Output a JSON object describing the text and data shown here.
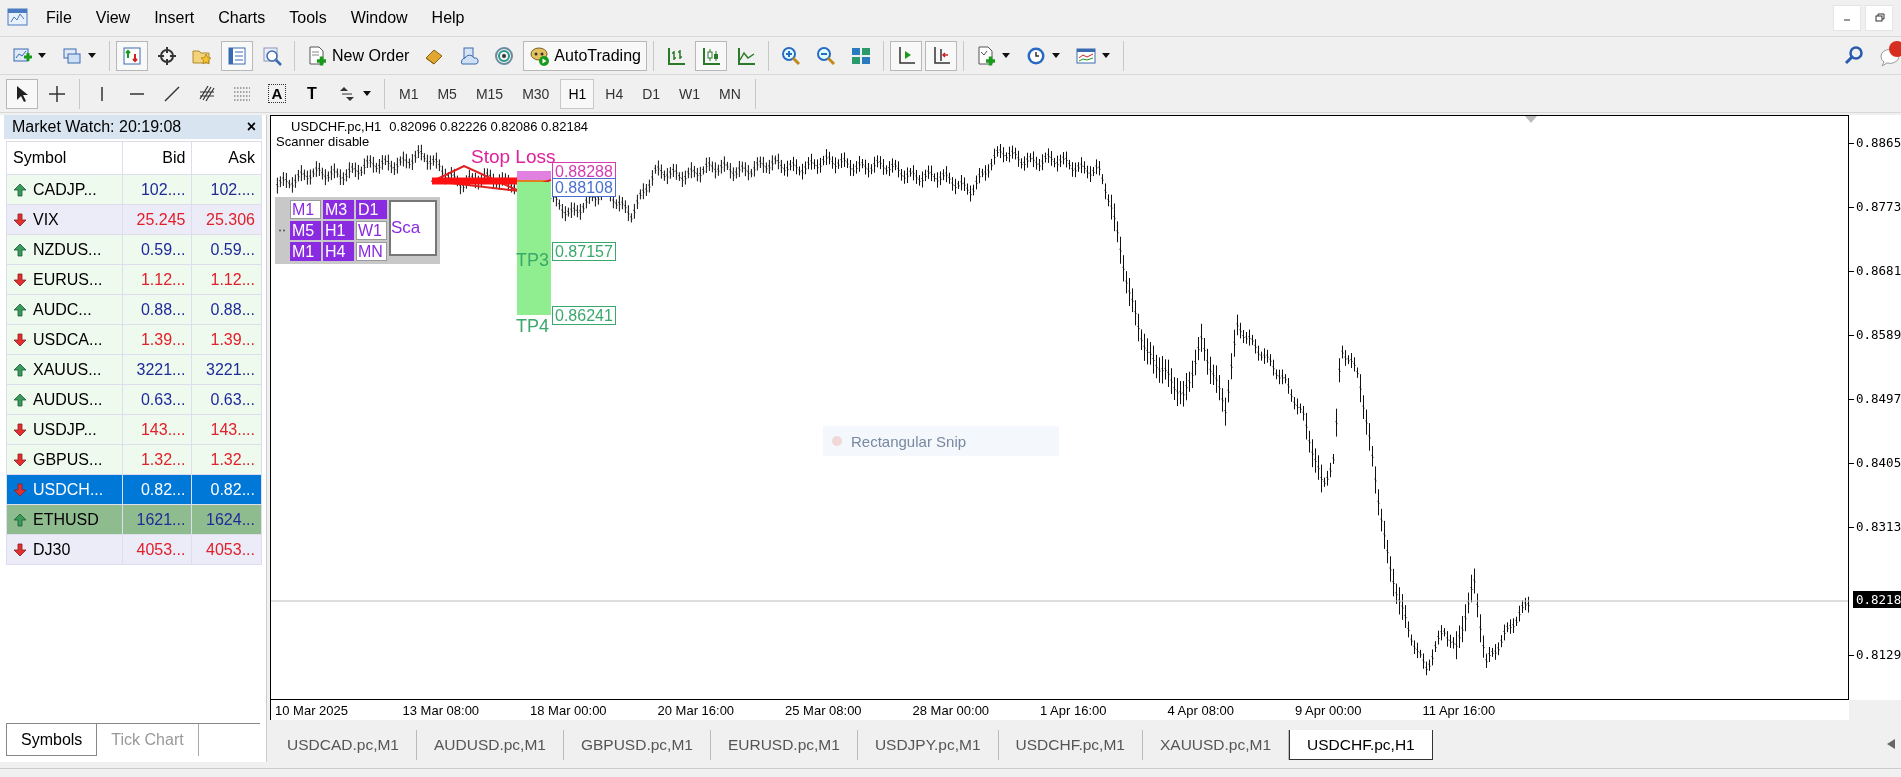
{
  "menu": {
    "items": [
      "File",
      "View",
      "Insert",
      "Charts",
      "Tools",
      "Window",
      "Help"
    ]
  },
  "toolbar": [
    [
      {
        "pressed": false,
        "dropdown": true
      },
      {
        "pressed": false,
        "dropdown": true
      }
    ],
    [
      {
        "pressed": true
      },
      {
        "pressed": false
      },
      {
        "pressed": false
      },
      {
        "pressed": true
      },
      {
        "pressed": false
      }
    ],
    [
      {
        "pressed": false,
        "label": "New Order"
      },
      {
        "pressed": false
      },
      {
        "pressed": false
      },
      {
        "pressed": false
      },
      {
        "pressed": true,
        "label": "AutoTrading"
      }
    ],
    [
      {
        "pressed": false
      },
      {
        "pressed": true
      },
      {
        "pressed": false
      }
    ],
    [
      {
        "pressed": false
      },
      {
        "pressed": false
      },
      {
        "pressed": false
      }
    ],
    [
      {
        "pressed": true
      },
      {
        "pressed": true
      }
    ],
    [
      {
        "pressed": false,
        "dropdown": true
      },
      {
        "pressed": false,
        "dropdown": true
      },
      {
        "pressed": false,
        "dropdown": true
      }
    ]
  ],
  "drawing_toolbar": [
    [
      {
        "pressed": true
      },
      {
        "pressed": false
      }
    ],
    [
      {
        "pressed": false
      },
      {
        "pressed": false
      },
      {
        "pressed": false
      },
      {
        "pressed": false
      },
      {
        "pressed": false
      },
      {
        "pressed": false,
        "label": "A"
      },
      {
        "pressed": false,
        "label": "T"
      },
      {
        "pressed": false,
        "dropdown": true
      }
    ]
  ],
  "timeframes": [
    {
      "label": "M1",
      "selected": false
    },
    {
      "label": "M5",
      "selected": false
    },
    {
      "label": "M15",
      "selected": false
    },
    {
      "label": "M30",
      "selected": false
    },
    {
      "label": "H1",
      "selected": true
    },
    {
      "label": "H4",
      "selected": false
    },
    {
      "label": "D1",
      "selected": false
    },
    {
      "label": "W1",
      "selected": false
    },
    {
      "label": "MN",
      "selected": false
    }
  ],
  "market_watch": {
    "title": "Market Watch: 20:19:08",
    "close": "×",
    "columns": [
      "Symbol",
      "Bid",
      "Ask"
    ],
    "rows": [
      {
        "symbol": "CADJP...",
        "bid": "102....",
        "ask": "102....",
        "kind": "up",
        "color": "#effaef",
        "selected": false
      },
      {
        "symbol": "VIX",
        "bid": "25.245",
        "ask": "25.306",
        "kind": "down",
        "color": "#ececf8",
        "selected": false
      },
      {
        "symbol": "NZDUS...",
        "bid": "0.59...",
        "ask": "0.59...",
        "kind": "up",
        "color": "#effaef",
        "selected": false
      },
      {
        "symbol": "EURUS...",
        "bid": "1.12...",
        "ask": "1.12...",
        "kind": "down",
        "color": "#effaef",
        "selected": false
      },
      {
        "symbol": "AUDC...",
        "bid": "0.88...",
        "ask": "0.88...",
        "kind": "up",
        "color": "#effaef",
        "selected": false
      },
      {
        "symbol": "USDCA...",
        "bid": "1.39...",
        "ask": "1.39...",
        "kind": "down",
        "color": "#effaef",
        "selected": false
      },
      {
        "symbol": "XAUUS...",
        "bid": "3221...",
        "ask": "3221...",
        "kind": "up",
        "color": "#effaef",
        "selected": false
      },
      {
        "symbol": "AUDUS...",
        "bid": "0.63...",
        "ask": "0.63...",
        "kind": "up",
        "color": "#effaef",
        "selected": false
      },
      {
        "symbol": "USDJP...",
        "bid": "143....",
        "ask": "143....",
        "kind": "down",
        "color": "#effaef",
        "selected": false
      },
      {
        "symbol": "GBPUS...",
        "bid": "1.32...",
        "ask": "1.32...",
        "kind": "down",
        "color": "#effaef",
        "selected": false
      },
      {
        "symbol": "USDCH...",
        "bid": "0.82...",
        "ask": "0.82...",
        "kind": "down",
        "color": "#0078d7",
        "selected": true
      },
      {
        "symbol": "ETHUSD",
        "bid": "1621...",
        "ask": "1624...",
        "kind": "up",
        "color": "#8fbc8f",
        "selected": false
      },
      {
        "symbol": "DJ30",
        "bid": "4053...",
        "ask": "4053...",
        "kind": "down",
        "color": "#ececf8",
        "selected": false
      }
    ],
    "tabs": [
      {
        "label": "Symbols",
        "selected": true
      },
      {
        "label": "Tick Chart",
        "selected": false
      }
    ]
  },
  "chart": {
    "symbol": "USDCHF.pc,H1",
    "ohlc": "0.82096 0.82226 0.82086 0.82184",
    "status": "Scanner disable",
    "scanner": {
      "buttons": [
        {
          "label": "M1",
          "on": false
        },
        {
          "label": "M3",
          "on": true
        },
        {
          "label": "D1",
          "on": true
        },
        {
          "label": "M5",
          "on": true
        },
        {
          "label": "H1",
          "on": true
        },
        {
          "label": "W1",
          "on": false
        },
        {
          "label": "M1",
          "on": true
        },
        {
          "label": "H4",
          "on": true
        },
        {
          "label": "MN",
          "on": false
        }
      ],
      "scan": "Sca"
    },
    "stop_loss": "Stop Loss",
    "levels": [
      {
        "price": "0.88288",
        "color": "#d63bb0"
      },
      {
        "price": "0.88108",
        "color": "#4a6fd0"
      },
      {
        "price": "0.87157",
        "color": "#3aa86a"
      },
      {
        "price": "0.86241",
        "color": "#3aa86a"
      }
    ],
    "targets": [
      "TP3",
      "TP4"
    ],
    "snip": "Rectangular Snip",
    "price_axis": [
      "0.8865",
      "0.8773",
      "0.8681",
      "0.8589",
      "0.8497",
      "0.8405",
      "0.8313",
      "0.8129"
    ],
    "current_price": "0.8218",
    "time_axis": [
      "10 Mar 2025",
      "13 Mar 08:00",
      "18 Mar 00:00",
      "20 Mar 16:00",
      "25 Mar 08:00",
      "28 Mar 00:00",
      "1 Apr 16:00",
      "4 Apr 08:00",
      "9 Apr 00:00",
      "11 Apr 16:00"
    ]
  },
  "chart_tabs": [
    {
      "label": "USDCAD.pc,M1",
      "selected": false
    },
    {
      "label": "AUDUSD.pc,M1",
      "selected": false
    },
    {
      "label": "GBPUSD.pc,M1",
      "selected": false
    },
    {
      "label": "EURUSD.pc,M1",
      "selected": false
    },
    {
      "label": "USDJPY.pc,M1",
      "selected": false
    },
    {
      "label": "USDCHF.pc,M1",
      "selected": false
    },
    {
      "label": "XAUUSD.pc,M1",
      "selected": false
    },
    {
      "label": "USDCHF.pc,H1",
      "selected": true
    }
  ]
}
